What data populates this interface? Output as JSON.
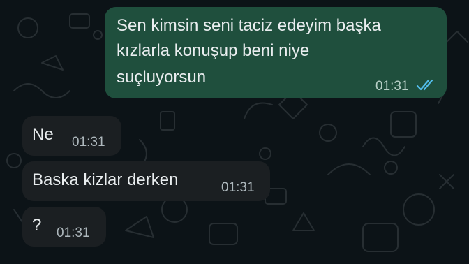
{
  "colors": {
    "background": "#0c1317",
    "outgoing_bubble": "#1f4f3d",
    "incoming_bubble": "#1b1f22",
    "text": "#e9edef",
    "read_ticks": "#53bdeb"
  },
  "messages": [
    {
      "direction": "outgoing",
      "lines": [
        "Sen kimsin seni taciz edeyim başka",
        "kızlarla konuşup beni niye",
        "suçluyorsun"
      ],
      "time": "01:31",
      "status_icon": "double-check-read-icon"
    },
    {
      "direction": "incoming",
      "text": "Ne",
      "time": "01:31"
    },
    {
      "direction": "incoming",
      "text": "Baska kizlar derken",
      "time": "01:31"
    },
    {
      "direction": "incoming",
      "text": "?",
      "time": "01:31"
    }
  ]
}
